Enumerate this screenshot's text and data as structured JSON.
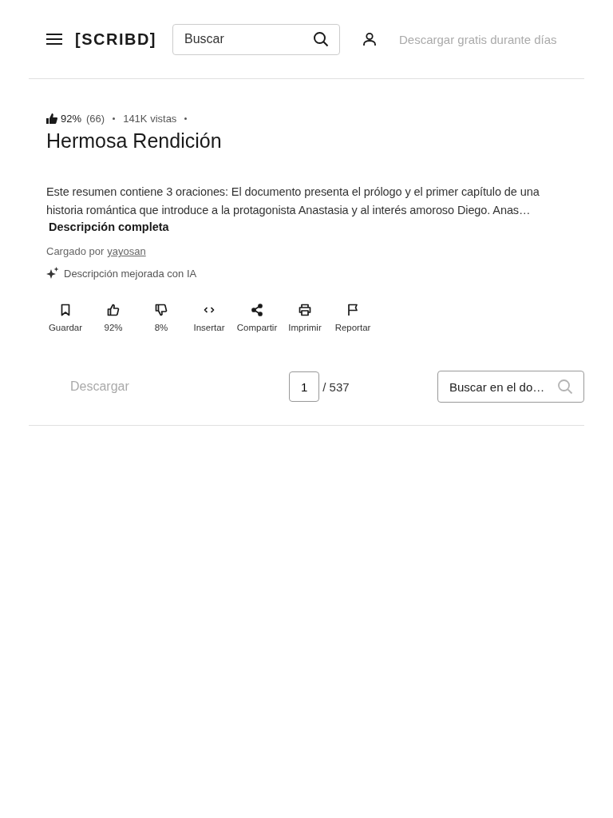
{
  "header": {
    "logo": "[SCRIBD]",
    "search": {
      "placeholder": "Buscar"
    },
    "download_button": {
      "label": "Descargar gratis durante días",
      "disabled": true
    }
  },
  "document": {
    "rating": "92%",
    "rating_count": "(66)",
    "views": "141K vistas",
    "title": "Hermosa Rendición",
    "summary": "Este resumen contiene 3 oraciones: El documento presenta el prólogo y el primer capítulo de una historia romántica que introduce a la protagonista Anastasia y al interés amoroso Diego. Anas…",
    "full_description_link": "Descripción completa",
    "uploaded_by_label": "Cargado por",
    "uploader": "yayosan",
    "ai_note": "Descripción mejorada con IA"
  },
  "actions": [
    {
      "kind": "save",
      "label": "Guardar"
    },
    {
      "kind": "like",
      "label": "92%"
    },
    {
      "kind": "dislike",
      "label": "8%"
    },
    {
      "kind": "embed",
      "label": "Insertar"
    },
    {
      "kind": "share",
      "label": "Compartir"
    },
    {
      "kind": "print",
      "label": "Imprimir"
    },
    {
      "kind": "report",
      "label": "Reportar"
    }
  ],
  "viewer_bar": {
    "download_button": {
      "label": "Descargar",
      "disabled": true
    },
    "page_input": "1",
    "page_total": "/ 537",
    "search": {
      "placeholder": "Buscar en el do…"
    }
  }
}
